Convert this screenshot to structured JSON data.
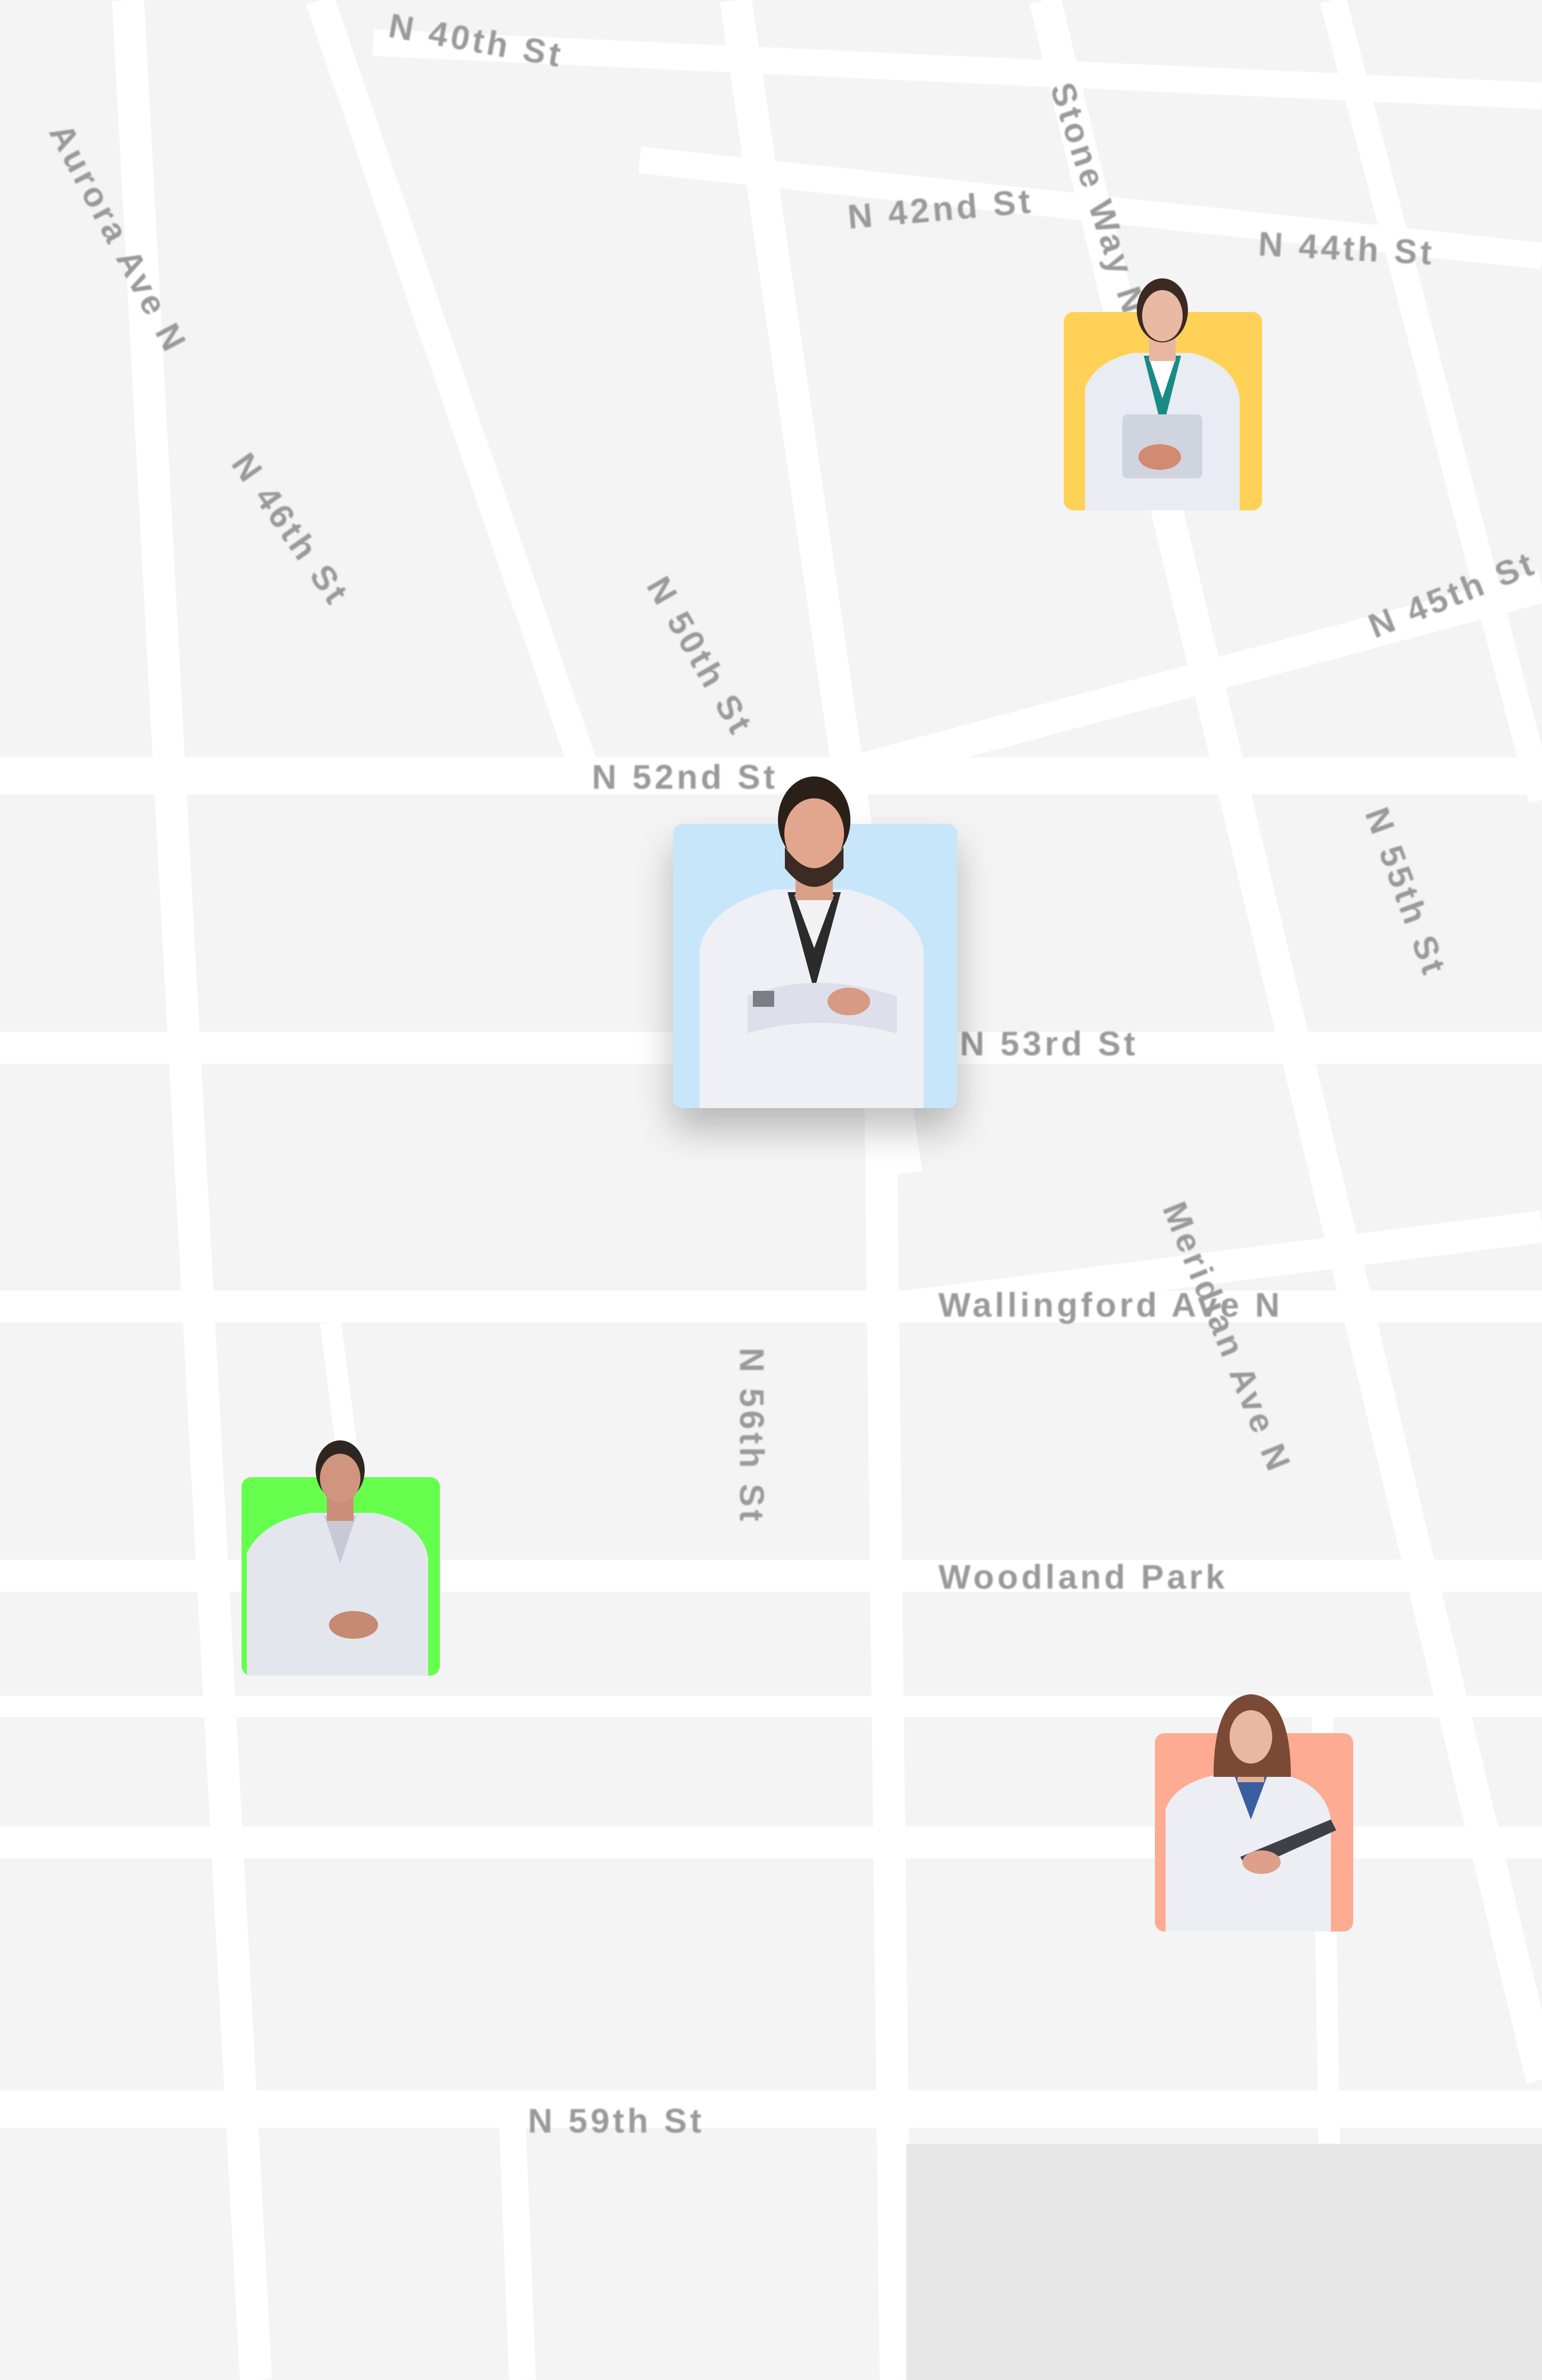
{
  "map": {
    "colors": {
      "land": "#f4f4f4",
      "road": "#ffffff",
      "label": "#9a9a9a",
      "park": "#e7e7e7"
    },
    "street_labels": [
      {
        "id": "label-1",
        "text": "N 40th St"
      },
      {
        "id": "label-2",
        "text": "N 42nd St"
      },
      {
        "id": "label-3",
        "text": "Aurora Ave N"
      },
      {
        "id": "label-4",
        "text": "N 44th St"
      },
      {
        "id": "label-5",
        "text": "Stone Way N"
      },
      {
        "id": "label-6",
        "text": "N 45th St"
      },
      {
        "id": "label-7",
        "text": "N 46th St"
      },
      {
        "id": "label-8",
        "text": "N 50th St"
      },
      {
        "id": "label-9",
        "text": "N 52nd St"
      },
      {
        "id": "label-10",
        "text": "N 53rd St"
      },
      {
        "id": "label-11",
        "text": "N 55th St"
      },
      {
        "id": "label-12",
        "text": "Wallingford Ave N"
      },
      {
        "id": "label-13",
        "text": "Meridian Ave N"
      },
      {
        "id": "label-14",
        "text": "N 56th St"
      },
      {
        "id": "label-15",
        "text": "Woodland Park"
      }
    ],
    "markers": [
      {
        "id": "doctor-female-teal",
        "icon": "doctor-avatar-icon",
        "background": "#ffd257",
        "accent": "#1a8a86",
        "hair": "#3a2a22"
      },
      {
        "id": "doctor-male-featured",
        "icon": "doctor-avatar-icon",
        "background": "#c8e6fa",
        "accent": "#2b2b2b",
        "hair": "#2b2018"
      },
      {
        "id": "doctor-male-green",
        "icon": "doctor-avatar-icon",
        "background": "#66ff4d",
        "accent": "#c9c9d6",
        "hair": "#2e2620"
      },
      {
        "id": "doctor-female-clipboard",
        "icon": "doctor-avatar-icon",
        "background": "#fdab92",
        "accent": "#3a5fa0",
        "hair": "#7a4a36"
      }
    ]
  }
}
